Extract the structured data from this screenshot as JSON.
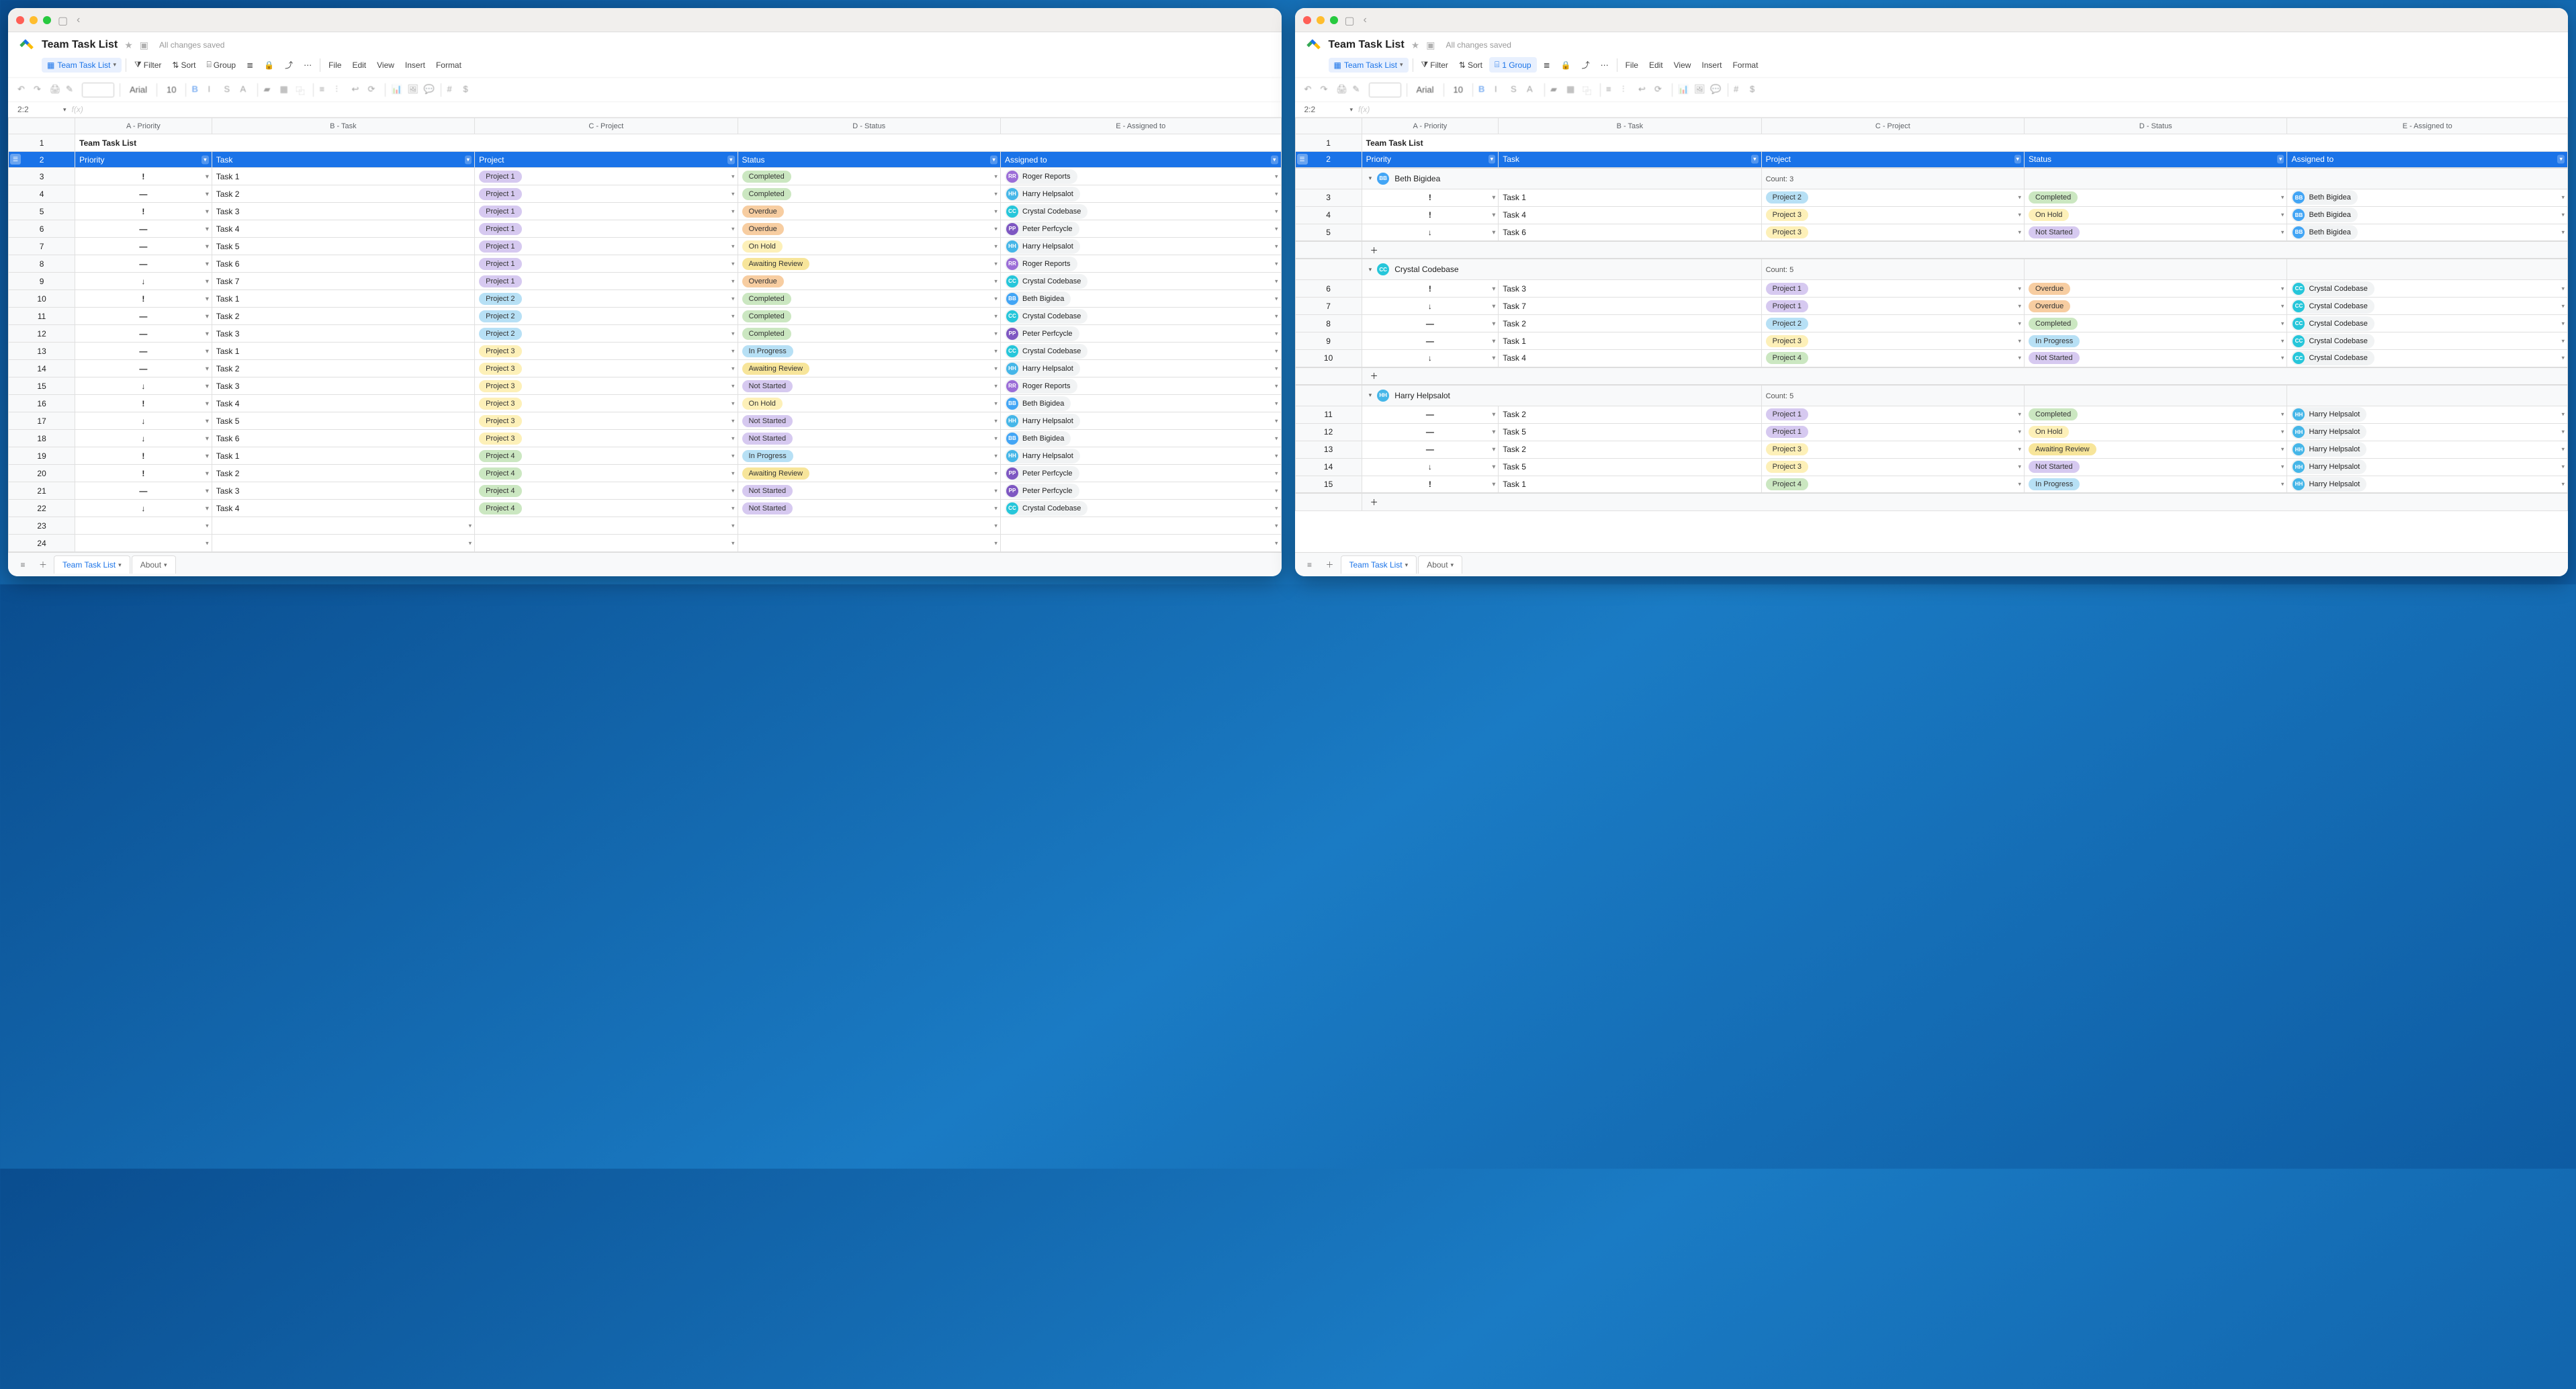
{
  "doc": {
    "title": "Team Task List",
    "saved": "All changes saved",
    "cell_ref": "2:2",
    "font_name": "Arial",
    "font_size": "10"
  },
  "toolbar": {
    "table_pill": "Team Task List",
    "filter": "Filter",
    "sort": "Sort",
    "group_none": "Group",
    "group_one": "1 Group",
    "menu": {
      "file": "File",
      "edit": "Edit",
      "view": "View",
      "insert": "Insert",
      "format": "Format"
    }
  },
  "columns": {
    "a": "A - Priority",
    "b": "B - Task",
    "c": "C - Project",
    "d": "D - Status",
    "e": "E - Assigned to"
  },
  "header2": {
    "title": "Team Task List",
    "priority": "Priority",
    "task": "Task",
    "project": "Project",
    "status": "Status",
    "assigned": "Assigned to"
  },
  "people": {
    "rr": {
      "name": "Roger Reports",
      "initials": "RR",
      "av": "av-rr"
    },
    "hh": {
      "name": "Harry Helpsalot",
      "initials": "HH",
      "av": "av-hh"
    },
    "cc": {
      "name": "Crystal Codebase",
      "initials": "CC",
      "av": "av-cc"
    },
    "pp": {
      "name": "Peter Perfcycle",
      "initials": "PP",
      "av": "av-pp"
    },
    "bb": {
      "name": "Beth Bigidea",
      "initials": "BB",
      "av": "av-bb"
    }
  },
  "left_rows": [
    {
      "n": 3,
      "prio": "high",
      "task": "Task 1",
      "proj": "Project 1",
      "status": "Completed",
      "who": "rr"
    },
    {
      "n": 4,
      "prio": "med",
      "task": "Task 2",
      "proj": "Project 1",
      "status": "Completed",
      "who": "hh"
    },
    {
      "n": 5,
      "prio": "high",
      "task": "Task 3",
      "proj": "Project 1",
      "status": "Overdue",
      "who": "cc"
    },
    {
      "n": 6,
      "prio": "med",
      "task": "Task 4",
      "proj": "Project 1",
      "status": "Overdue",
      "who": "pp"
    },
    {
      "n": 7,
      "prio": "med",
      "task": "Task 5",
      "proj": "Project 1",
      "status": "On Hold",
      "who": "hh"
    },
    {
      "n": 8,
      "prio": "med",
      "task": "Task 6",
      "proj": "Project 1",
      "status": "Awaiting Review",
      "who": "rr"
    },
    {
      "n": 9,
      "prio": "low",
      "task": "Task 7",
      "proj": "Project 1",
      "status": "Overdue",
      "who": "cc"
    },
    {
      "n": 10,
      "prio": "high",
      "task": "Task 1",
      "proj": "Project 2",
      "status": "Completed",
      "who": "bb"
    },
    {
      "n": 11,
      "prio": "med",
      "task": "Task 2",
      "proj": "Project 2",
      "status": "Completed",
      "who": "cc"
    },
    {
      "n": 12,
      "prio": "med",
      "task": "Task 3",
      "proj": "Project 2",
      "status": "Completed",
      "who": "pp"
    },
    {
      "n": 13,
      "prio": "med",
      "task": "Task 1",
      "proj": "Project 3",
      "status": "In Progress",
      "who": "cc"
    },
    {
      "n": 14,
      "prio": "med",
      "task": "Task 2",
      "proj": "Project 3",
      "status": "Awaiting Review",
      "who": "hh"
    },
    {
      "n": 15,
      "prio": "low",
      "task": "Task 3",
      "proj": "Project 3",
      "status": "Not Started",
      "who": "rr"
    },
    {
      "n": 16,
      "prio": "high",
      "task": "Task 4",
      "proj": "Project 3",
      "status": "On Hold",
      "who": "bb"
    },
    {
      "n": 17,
      "prio": "low",
      "task": "Task 5",
      "proj": "Project 3",
      "status": "Not Started",
      "who": "hh"
    },
    {
      "n": 18,
      "prio": "low",
      "task": "Task 6",
      "proj": "Project 3",
      "status": "Not Started",
      "who": "bb"
    },
    {
      "n": 19,
      "prio": "high",
      "task": "Task 1",
      "proj": "Project 4",
      "status": "In Progress",
      "who": "hh"
    },
    {
      "n": 20,
      "prio": "high",
      "task": "Task 2",
      "proj": "Project 4",
      "status": "Awaiting Review",
      "who": "pp"
    },
    {
      "n": 21,
      "prio": "med",
      "task": "Task 3",
      "proj": "Project 4",
      "status": "Not Started",
      "who": "pp"
    },
    {
      "n": 22,
      "prio": "low",
      "task": "Task 4",
      "proj": "Project 4",
      "status": "Not Started",
      "who": "cc"
    },
    {
      "n": 23,
      "empty": true
    },
    {
      "n": 24,
      "empty": true
    }
  ],
  "right_groups": [
    {
      "who": "bb",
      "count_label": "Count: 3",
      "rows": [
        {
          "n": 3,
          "prio": "high",
          "task": "Task 1",
          "proj": "Project 2",
          "status": "Completed",
          "who": "bb"
        },
        {
          "n": 4,
          "prio": "high",
          "task": "Task 4",
          "proj": "Project 3",
          "status": "On Hold",
          "who": "bb"
        },
        {
          "n": 5,
          "prio": "low",
          "task": "Task 6",
          "proj": "Project 3",
          "status": "Not Started",
          "who": "bb"
        }
      ]
    },
    {
      "who": "cc",
      "count_label": "Count: 5",
      "rows": [
        {
          "n": 6,
          "prio": "high",
          "task": "Task 3",
          "proj": "Project 1",
          "status": "Overdue",
          "who": "cc"
        },
        {
          "n": 7,
          "prio": "low",
          "task": "Task 7",
          "proj": "Project 1",
          "status": "Overdue",
          "who": "cc"
        },
        {
          "n": 8,
          "prio": "med",
          "task": "Task 2",
          "proj": "Project 2",
          "status": "Completed",
          "who": "cc"
        },
        {
          "n": 9,
          "prio": "med",
          "task": "Task 1",
          "proj": "Project 3",
          "status": "In Progress",
          "who": "cc"
        },
        {
          "n": 10,
          "prio": "low",
          "task": "Task 4",
          "proj": "Project 4",
          "status": "Not Started",
          "who": "cc"
        }
      ]
    },
    {
      "who": "hh",
      "count_label": "Count: 5",
      "rows": [
        {
          "n": 11,
          "prio": "med",
          "task": "Task 2",
          "proj": "Project 1",
          "status": "Completed",
          "who": "hh"
        },
        {
          "n": 12,
          "prio": "med",
          "task": "Task 5",
          "proj": "Project 1",
          "status": "On Hold",
          "who": "hh"
        },
        {
          "n": 13,
          "prio": "med",
          "task": "Task 2",
          "proj": "Project 3",
          "status": "Awaiting Review",
          "who": "hh"
        },
        {
          "n": 14,
          "prio": "low",
          "task": "Task 5",
          "proj": "Project 3",
          "status": "Not Started",
          "who": "hh"
        },
        {
          "n": 15,
          "prio": "high",
          "task": "Task 1",
          "proj": "Project 4",
          "status": "In Progress",
          "who": "hh"
        }
      ]
    }
  ],
  "footer": {
    "tab1": "Team Task List",
    "tab2": "About"
  },
  "maps": {
    "priority_glyph": {
      "high": "!",
      "med": "—",
      "low": "↓"
    },
    "priority_class": {
      "high": "p-high",
      "med": "p-med",
      "low": "p-low"
    },
    "project_class": {
      "Project 1": "proj-1",
      "Project 2": "proj-2",
      "Project 3": "proj-3",
      "Project 4": "proj-4"
    },
    "status_class": {
      "Completed": "st-completed",
      "Overdue": "st-overdue",
      "On Hold": "st-onhold",
      "Awaiting Review": "st-awaiting",
      "In Progress": "st-inprogress",
      "Not Started": "st-notstarted"
    }
  }
}
